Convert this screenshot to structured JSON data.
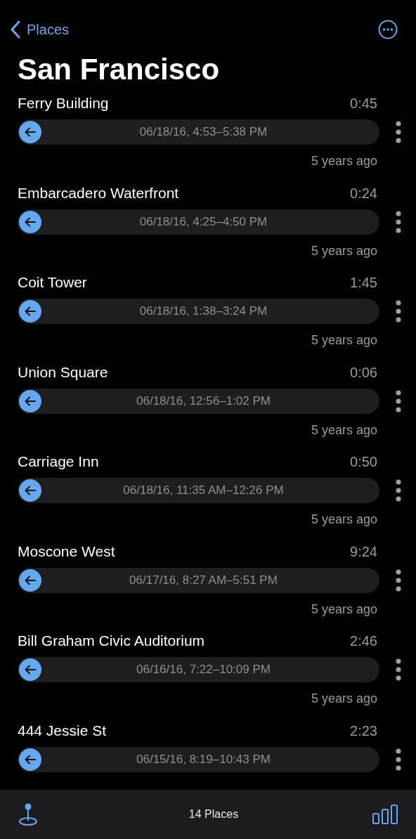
{
  "nav": {
    "back": "Places",
    "title": "San Francisco"
  },
  "places": [
    {
      "name": "Ferry Building",
      "duration": "0:45",
      "range": "06/18/16, 4:53–5:38 PM",
      "ago": "5 years ago"
    },
    {
      "name": "Embarcadero Waterfront",
      "duration": "0:24",
      "range": "06/18/16, 4:25–4:50 PM",
      "ago": "5 years ago"
    },
    {
      "name": "Coit Tower",
      "duration": "1:45",
      "range": "06/18/16, 1:38–3:24 PM",
      "ago": "5 years ago"
    },
    {
      "name": "Union Square",
      "duration": "0:06",
      "range": "06/18/16, 12:56–1:02 PM",
      "ago": "5 years ago"
    },
    {
      "name": "Carriage Inn",
      "duration": "0:50",
      "range": "06/18/16, 11:35 AM–12:26 PM",
      "ago": "5 years ago"
    },
    {
      "name": "Moscone West",
      "duration": "9:24",
      "range": "06/17/16, 8:27 AM–5:51 PM",
      "ago": "5 years ago"
    },
    {
      "name": "Bill Graham Civic Auditorium",
      "duration": "2:46",
      "range": "06/16/16, 7:22–10:09 PM",
      "ago": "5 years ago"
    },
    {
      "name": "444 Jessie St",
      "duration": "2:23",
      "range": "06/15/16, 8:19–10:43 PM"
    }
  ],
  "toolbar": {
    "count": "14 Places"
  }
}
